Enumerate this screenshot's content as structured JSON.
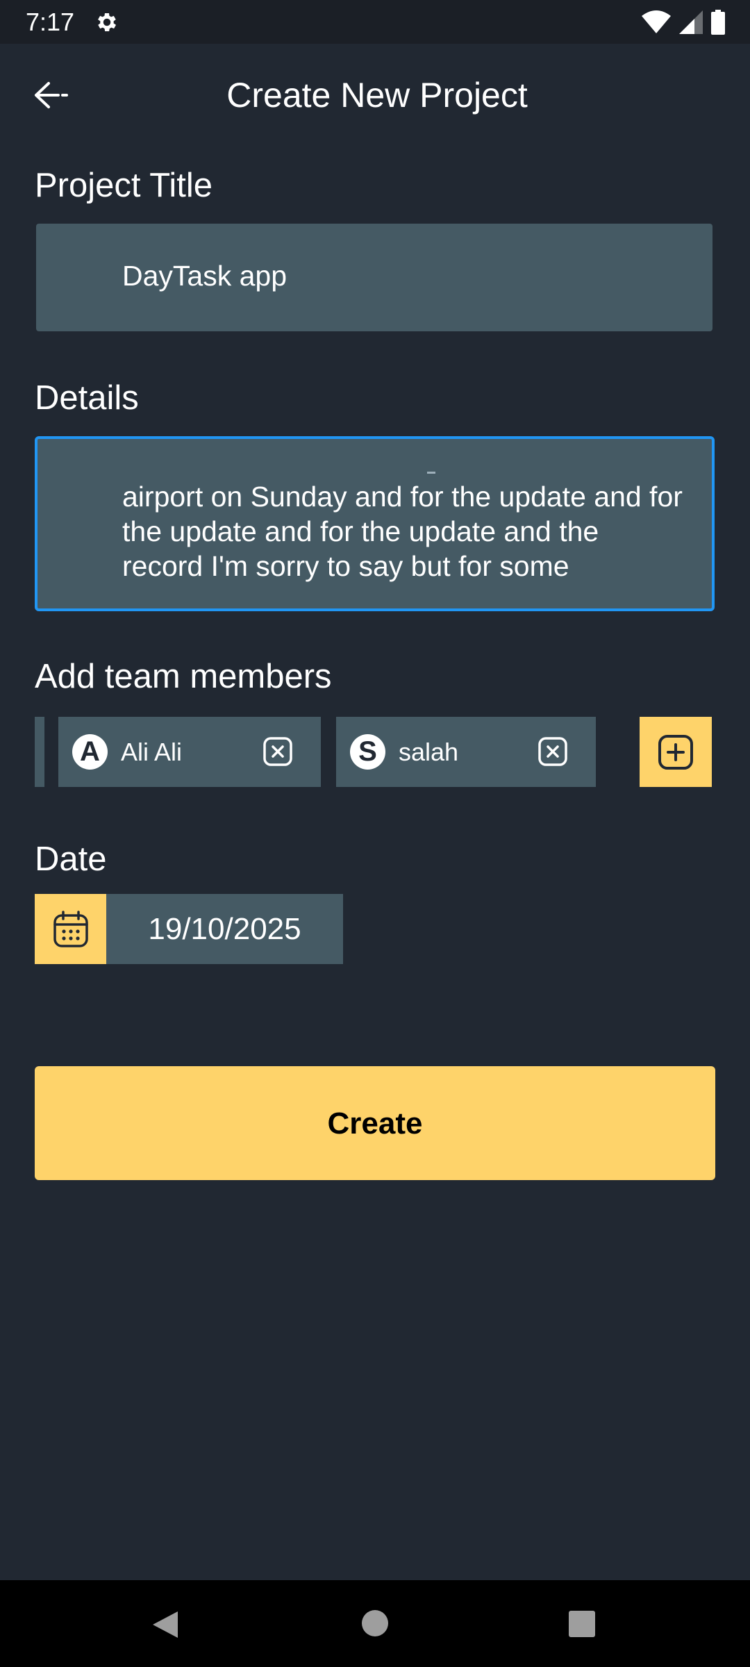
{
  "status_bar": {
    "time": "7:17"
  },
  "header": {
    "title": "Create New Project"
  },
  "form": {
    "project_title_label": "Project Title",
    "project_title_value": "DayTask app",
    "details_label": "Details",
    "details_value": "airport on Sunday and for the update and for the update and for the update and the record I'm sorry to say but for some",
    "team_label": "Add team members",
    "members": [
      {
        "initial": "A",
        "name": "Ali Ali"
      },
      {
        "initial": "S",
        "name": "salah"
      }
    ],
    "date_label": "Date",
    "date_value": "19/10/2025",
    "create_label": "Create"
  },
  "colors": {
    "background": "#212832",
    "field": "#455a64",
    "accent": "#fed36a",
    "focus": "#2196f3"
  },
  "icons": [
    "settings-gear-icon",
    "wifi-icon",
    "signal-icon",
    "battery-icon",
    "back-arrow-icon",
    "remove-member-icon",
    "add-member-icon",
    "calendar-icon"
  ]
}
